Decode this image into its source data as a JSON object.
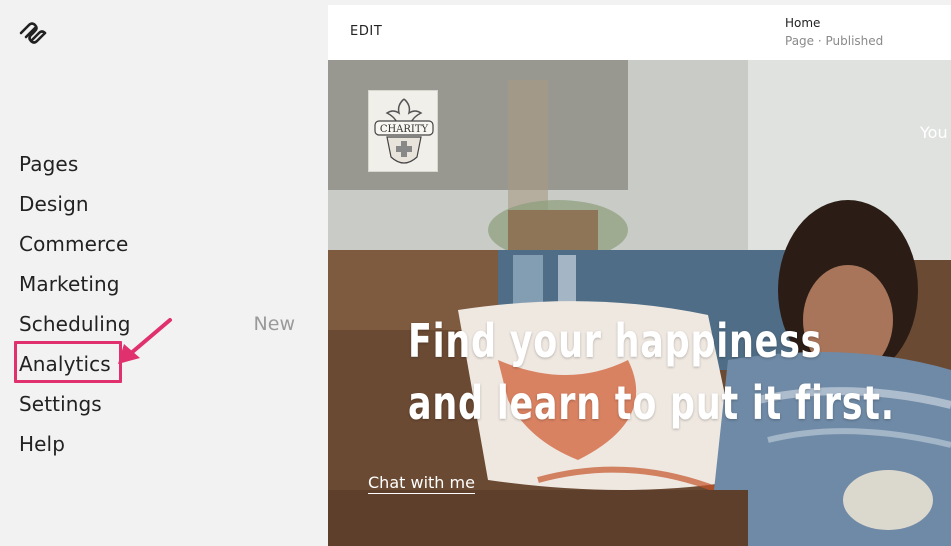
{
  "sidebar": {
    "logo_icon": "squarespace-logo-icon",
    "items": [
      {
        "label": "Pages",
        "badge": ""
      },
      {
        "label": "Design",
        "badge": ""
      },
      {
        "label": "Commerce",
        "badge": ""
      },
      {
        "label": "Marketing",
        "badge": ""
      },
      {
        "label": "Scheduling",
        "badge": "New"
      },
      {
        "label": "Analytics",
        "badge": ""
      },
      {
        "label": "Settings",
        "badge": ""
      },
      {
        "label": "Help",
        "badge": ""
      }
    ]
  },
  "annotation": {
    "highlight_color": "#e0316e",
    "target": "Analytics"
  },
  "preview": {
    "edit_label": "EDIT",
    "page_title": "Home",
    "page_status": "Page · Published",
    "hero": {
      "logo_text": "CHARITY",
      "nav_link": "You",
      "headline_line1": "Find your happiness",
      "headline_line2": "and learn to put it first.",
      "cta_label": "Chat with me"
    }
  }
}
